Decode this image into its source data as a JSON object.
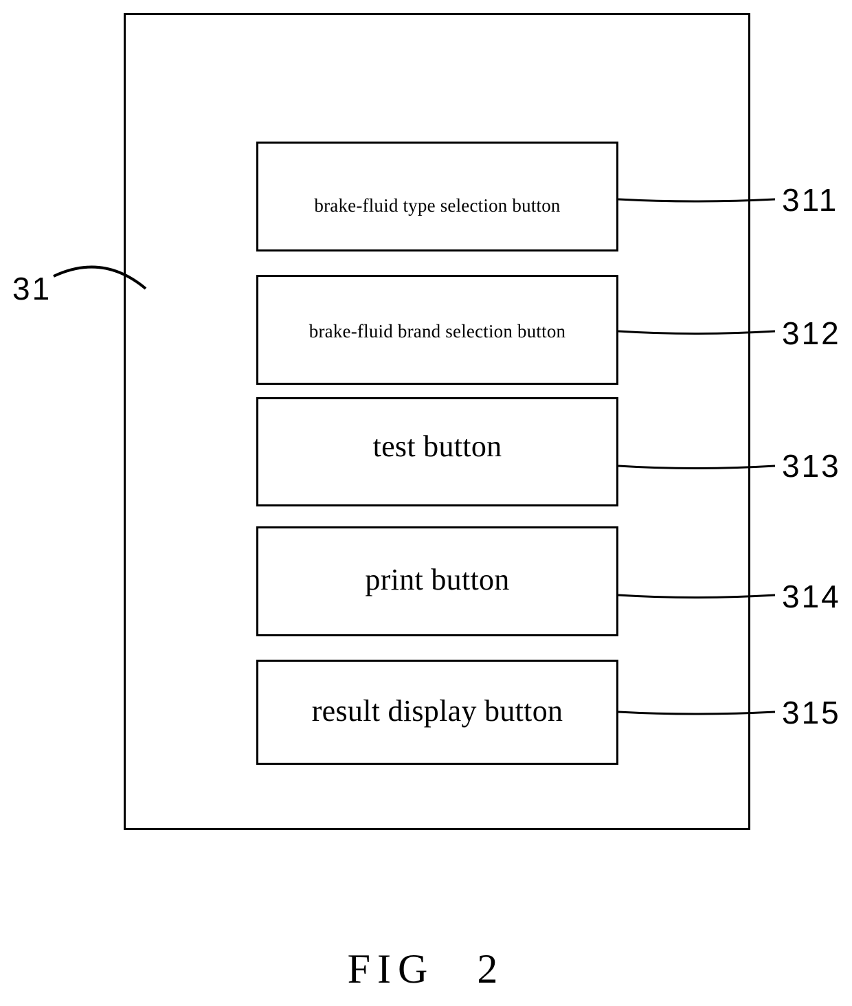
{
  "figure": {
    "caption_label": "FIG",
    "caption_number": "2",
    "container_reference": "31"
  },
  "container": {
    "reference": "31",
    "buttons": [
      {
        "id": "311",
        "label": "brake-fluid type selection button",
        "reference": "311",
        "text_size": "small"
      },
      {
        "id": "312",
        "label": "brake-fluid brand selection button",
        "reference": "312",
        "text_size": "small"
      },
      {
        "id": "313",
        "label": "test button",
        "reference": "313",
        "text_size": "large"
      },
      {
        "id": "314",
        "label": "print button",
        "reference": "314",
        "text_size": "large"
      },
      {
        "id": "315",
        "label": "result display button",
        "reference": "315",
        "text_size": "large"
      }
    ]
  },
  "style": {
    "line_color": "#000000",
    "background_color": "#ffffff"
  }
}
